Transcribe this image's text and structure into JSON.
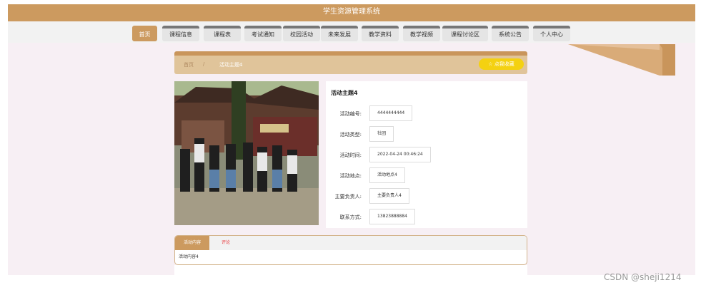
{
  "app": {
    "title": "学生资源管理系统"
  },
  "nav": [
    {
      "label": "首页",
      "active": true
    },
    {
      "label": "课程信息"
    },
    {
      "label": "课程表"
    },
    {
      "label": "考试通知"
    },
    {
      "label": "校园活动"
    },
    {
      "label": "未来发展"
    },
    {
      "label": "教学资料"
    },
    {
      "label": "教学视频"
    },
    {
      "label": "课程讨论区"
    },
    {
      "label": "系统公告"
    },
    {
      "label": "个人中心"
    }
  ],
  "breadcrumb": {
    "home": "首页",
    "separator": "/",
    "current": "活动主题4"
  },
  "favorite_button": {
    "label": "☆ 点我收藏"
  },
  "detail": {
    "title": "活动主题4",
    "fields": [
      {
        "label": "活动编号:",
        "value": "4444444444"
      },
      {
        "label": "活动类型:",
        "value": "社团"
      },
      {
        "label": "活动时间:",
        "value": "2022-04-24 00:46:24"
      },
      {
        "label": "活动地点:",
        "value": "活动地点4"
      },
      {
        "label": "主要负责人:",
        "value": "主要负责人4"
      },
      {
        "label": "联系方式:",
        "value": "13823888884"
      }
    ]
  },
  "tabs": {
    "content_label": "活动内容",
    "comment_label": "评论",
    "content_text": "活动内容4"
  },
  "watermark": "CSDN @sheji1214",
  "colors": {
    "accent": "#cc9a5f",
    "favorite": "#f4d111",
    "comment": "#e8393c",
    "page_bg": "#f7eff4"
  }
}
